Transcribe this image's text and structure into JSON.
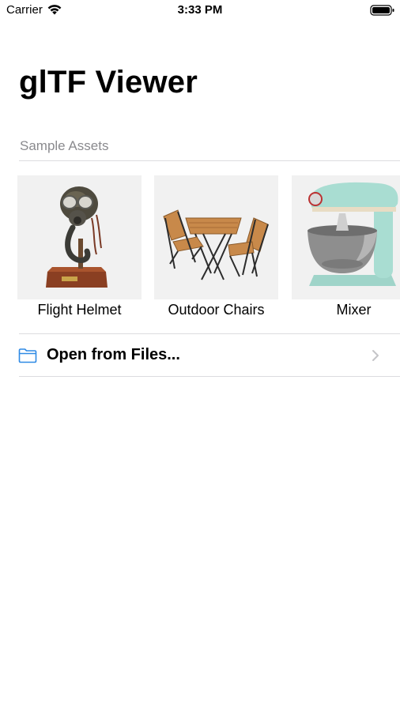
{
  "status_bar": {
    "carrier": "Carrier",
    "time": "3:33 PM"
  },
  "header": {
    "title": "glTF Viewer"
  },
  "sample_assets": {
    "section_title": "Sample Assets",
    "items": [
      {
        "label": "Flight Helmet",
        "icon": "flight-helmet-thumbnail"
      },
      {
        "label": "Outdoor Chairs",
        "icon": "outdoor-chairs-thumbnail"
      },
      {
        "label": "Mixer",
        "icon": "mixer-thumbnail"
      }
    ]
  },
  "actions": {
    "open_files_label": "Open from Files..."
  },
  "colors": {
    "accent": "#2f8ae5",
    "secondary_text": "#8a8a8e",
    "separator": "#dcdcdf",
    "thumb_bg": "#f1f1f1"
  }
}
